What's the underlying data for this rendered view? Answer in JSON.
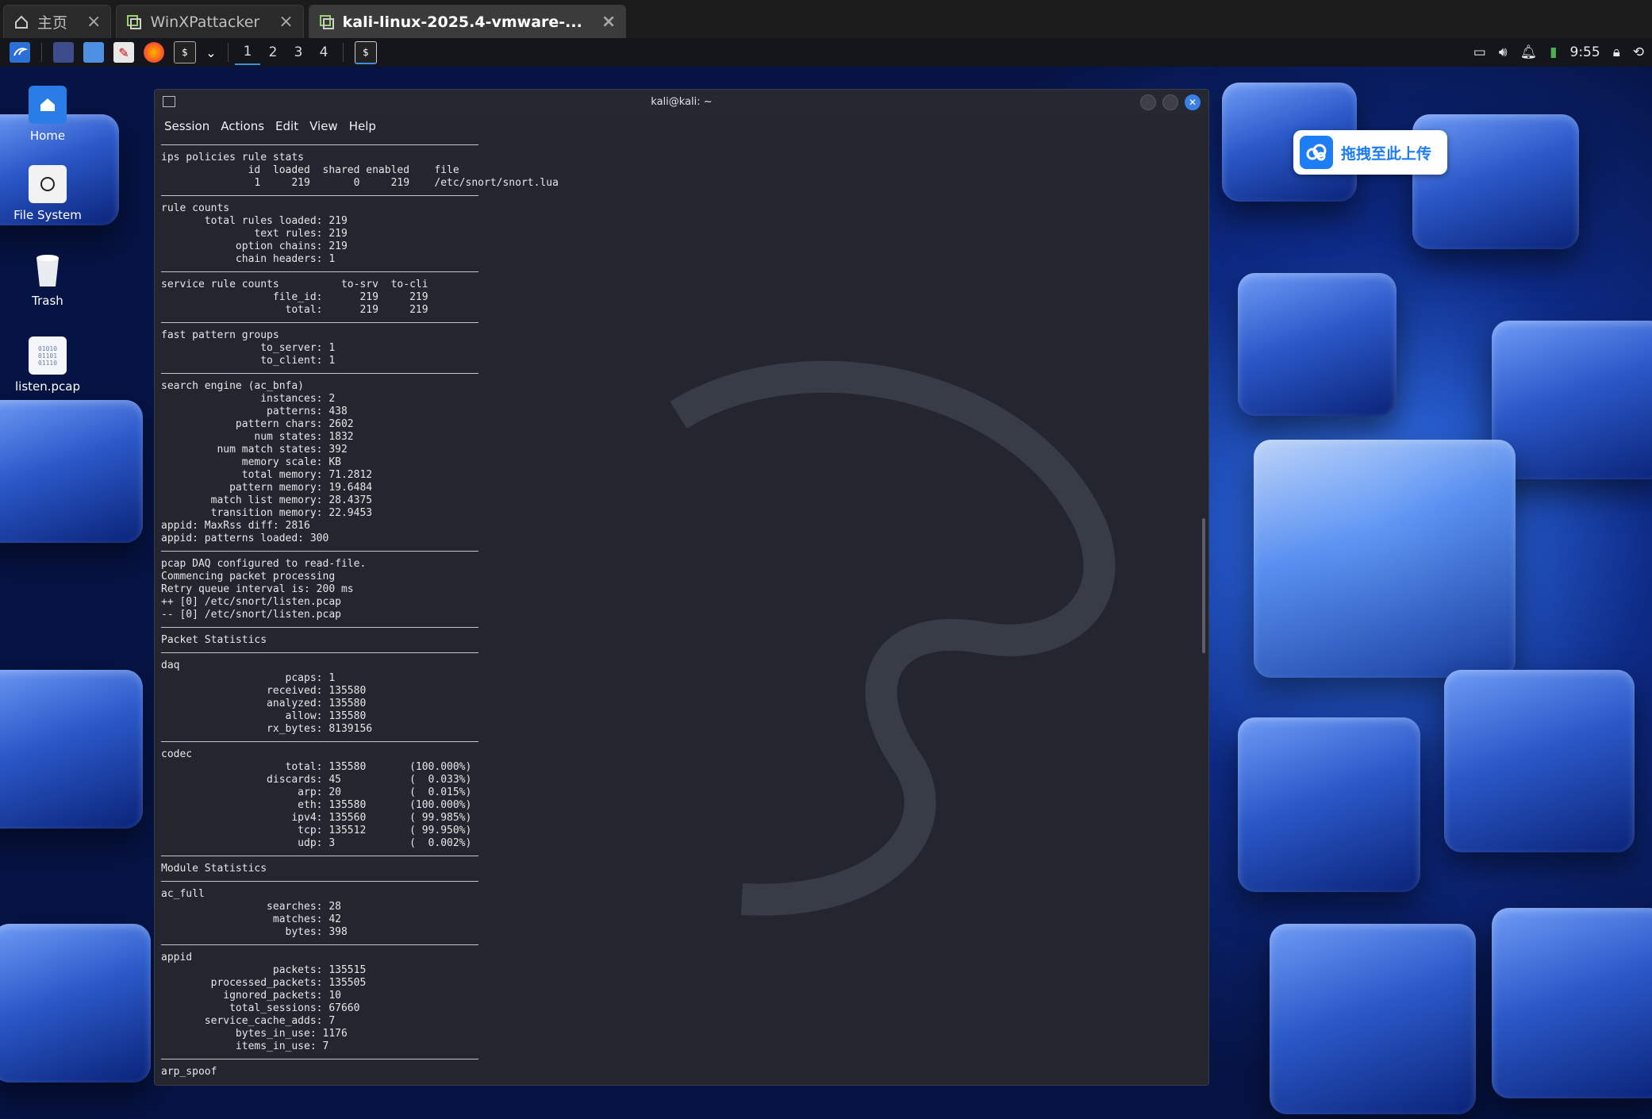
{
  "vm_tabs": [
    {
      "label": "主页",
      "icon": "home-icon",
      "active": false
    },
    {
      "label": "WinXPattacker",
      "icon": "vm-icon",
      "active": false
    },
    {
      "label": "kali-linux-2025.4-vmware-...",
      "icon": "vm-icon",
      "active": true
    }
  ],
  "panel": {
    "workspaces": [
      "1",
      "2",
      "3",
      "4"
    ],
    "active_workspace": "1",
    "clock": "9:55"
  },
  "desktop_icons": [
    {
      "label": "Home",
      "icon": "home-folder-icon"
    },
    {
      "label": "File System",
      "icon": "drive-icon"
    },
    {
      "label": "Trash",
      "icon": "trash-icon"
    },
    {
      "label": "listen.pcap",
      "icon": "binary-file-icon"
    }
  ],
  "upload_widget": {
    "label": "拖拽至此上传",
    "icon": "cloud-upload-icon"
  },
  "terminal": {
    "title": "kali@kali: ~",
    "menu": [
      "Session",
      "Actions",
      "Edit",
      "View",
      "Help"
    ],
    "lines": [
      "---",
      "ips policies rule stats",
      "              id  loaded  shared enabled    file",
      "               1     219       0     219    /etc/snort/snort.lua",
      "---",
      "rule counts",
      "       total rules loaded: 219",
      "               text rules: 219",
      "            option chains: 219",
      "            chain headers: 1",
      "---",
      "service rule counts          to-srv  to-cli",
      "                  file_id:      219     219",
      "                    total:      219     219",
      "---",
      "fast pattern groups",
      "                to_server: 1",
      "                to_client: 1",
      "---",
      "search engine (ac_bnfa)",
      "                instances: 2",
      "                 patterns: 438",
      "            pattern chars: 2602",
      "               num states: 1832",
      "         num match states: 392",
      "             memory scale: KB",
      "             total memory: 71.2812",
      "           pattern memory: 19.6484",
      "        match list memory: 28.4375",
      "        transition memory: 22.9453",
      "appid: MaxRss diff: 2816",
      "appid: patterns loaded: 300",
      "---",
      "pcap DAQ configured to read-file.",
      "Commencing packet processing",
      "Retry queue interval is: 200 ms",
      "++ [0] /etc/snort/listen.pcap",
      "-- [0] /etc/snort/listen.pcap",
      "---",
      "Packet Statistics",
      "---",
      "daq",
      "                    pcaps: 1",
      "                 received: 135580",
      "                 analyzed: 135580",
      "                    allow: 135580",
      "                 rx_bytes: 8139156",
      "---",
      "codec",
      "                    total: 135580       (100.000%)",
      "                 discards: 45           (  0.033%)",
      "                      arp: 20           (  0.015%)",
      "                      eth: 135580       (100.000%)",
      "                     ipv4: 135560       ( 99.985%)",
      "                      tcp: 135512       ( 99.950%)",
      "                      udp: 3            (  0.002%)",
      "---",
      "Module Statistics",
      "---",
      "ac_full",
      "                 searches: 28",
      "                  matches: 42",
      "                    bytes: 398",
      "---",
      "appid",
      "                  packets: 135515",
      "        processed_packets: 135505",
      "          ignored_packets: 10",
      "           total_sessions: 67660",
      "       service_cache_adds: 7",
      "            bytes_in_use: 1176",
      "            items_in_use: 7",
      "---",
      "arp_spoof"
    ]
  },
  "colors": {
    "terminal_bg": "#23262f",
    "panel_bg": "#14161c",
    "accent": "#3b7fe6"
  }
}
